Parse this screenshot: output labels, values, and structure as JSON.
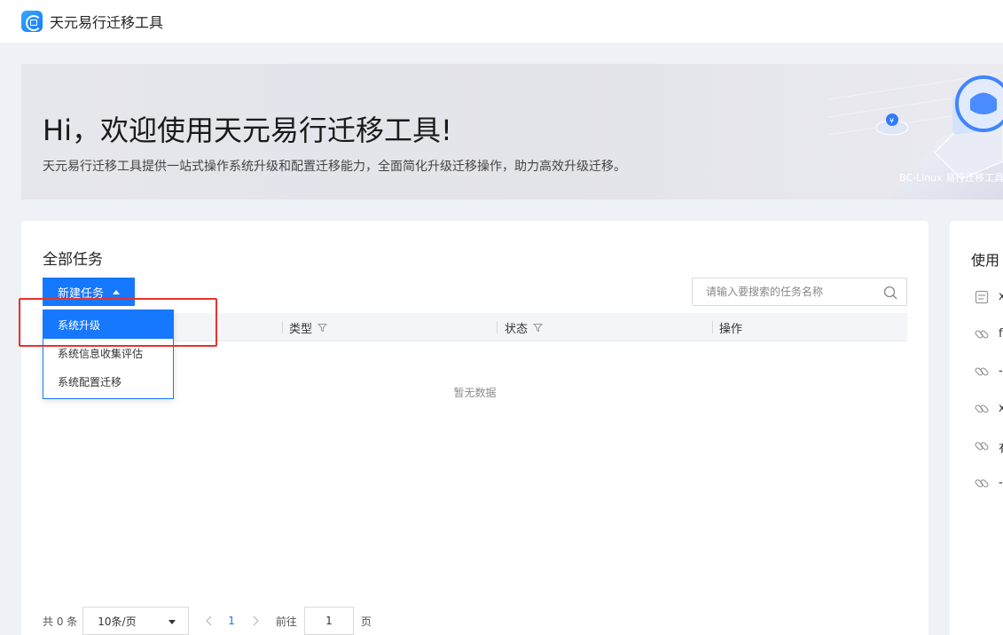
{
  "app": {
    "title": "天元易行迁移工具"
  },
  "banner": {
    "title": "Hi，欢迎使用天元易行迁移工具!",
    "description": "天元易行迁移工具提供一站式操作系统升级和配置迁移能力，全面简化升级迁移操作，助力高效升级迁移。",
    "art_caption": "BC-Linux 易行迁移工具"
  },
  "tasks": {
    "section_title": "全部任务",
    "new_task_label": "新建任务",
    "search_placeholder": "请输入要搜索的任务名称",
    "columns": [
      {
        "label": ""
      },
      {
        "label": "类型"
      },
      {
        "label": "状态"
      },
      {
        "label": "操作"
      }
    ],
    "empty_text": "暂无数据",
    "dropdown": [
      {
        "label": "系统升级",
        "active": true
      },
      {
        "label": "系统信息收集评估",
        "active": false
      },
      {
        "label": "系统配置迁移",
        "active": false
      }
    ]
  },
  "pagination": {
    "total": "共 0 条",
    "page_size": "10条/页",
    "current_page": "1",
    "goto_label": "前往",
    "goto_value": "1",
    "page_unit": "页"
  },
  "side_panel": {
    "title": "使用",
    "items": [
      {
        "icon": "document-icon",
        "text": "x"
      },
      {
        "icon": "link-icon",
        "text": "f"
      },
      {
        "icon": "link-icon",
        "text": "-"
      },
      {
        "icon": "link-icon",
        "text": "x"
      },
      {
        "icon": "link-icon",
        "text": "有"
      },
      {
        "icon": "link-icon",
        "text": "-"
      }
    ]
  },
  "colors": {
    "primary": "#1677ff",
    "page_background": "#eef1f6",
    "highlight": "#e8322e"
  }
}
